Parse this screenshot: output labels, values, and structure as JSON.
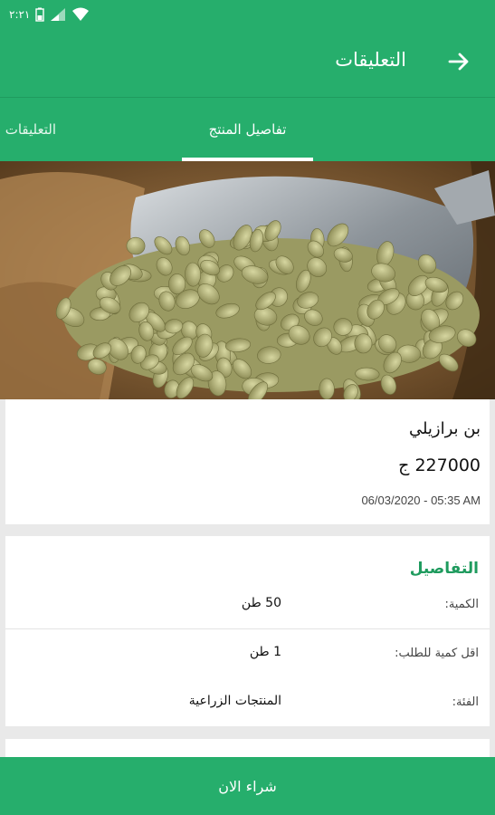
{
  "status_bar": {
    "time": "٢:٢١"
  },
  "header": {
    "title": "التعليقات",
    "back_icon": "arrow-right-icon"
  },
  "tabs": [
    {
      "label": "تفاصيل المنتج",
      "active": true
    },
    {
      "label": "التعليقات",
      "active": false
    }
  ],
  "product": {
    "name": "بن برازيلي",
    "price": "227000 ج",
    "date": "06/03/2020 - 05:35 AM"
  },
  "details": {
    "title": "التفاصيل",
    "rows": [
      {
        "label": "الكمية:",
        "value": "50 طن"
      },
      {
        "label": "اقل كمية للطلب:",
        "value": "1 طن"
      },
      {
        "label": "الفئة:",
        "value": "المنتجات الزراعية"
      }
    ]
  },
  "buy_button": {
    "label": "شراء الان"
  },
  "colors": {
    "primary": "#26ae6c",
    "accent_text": "#1f9b5e"
  }
}
